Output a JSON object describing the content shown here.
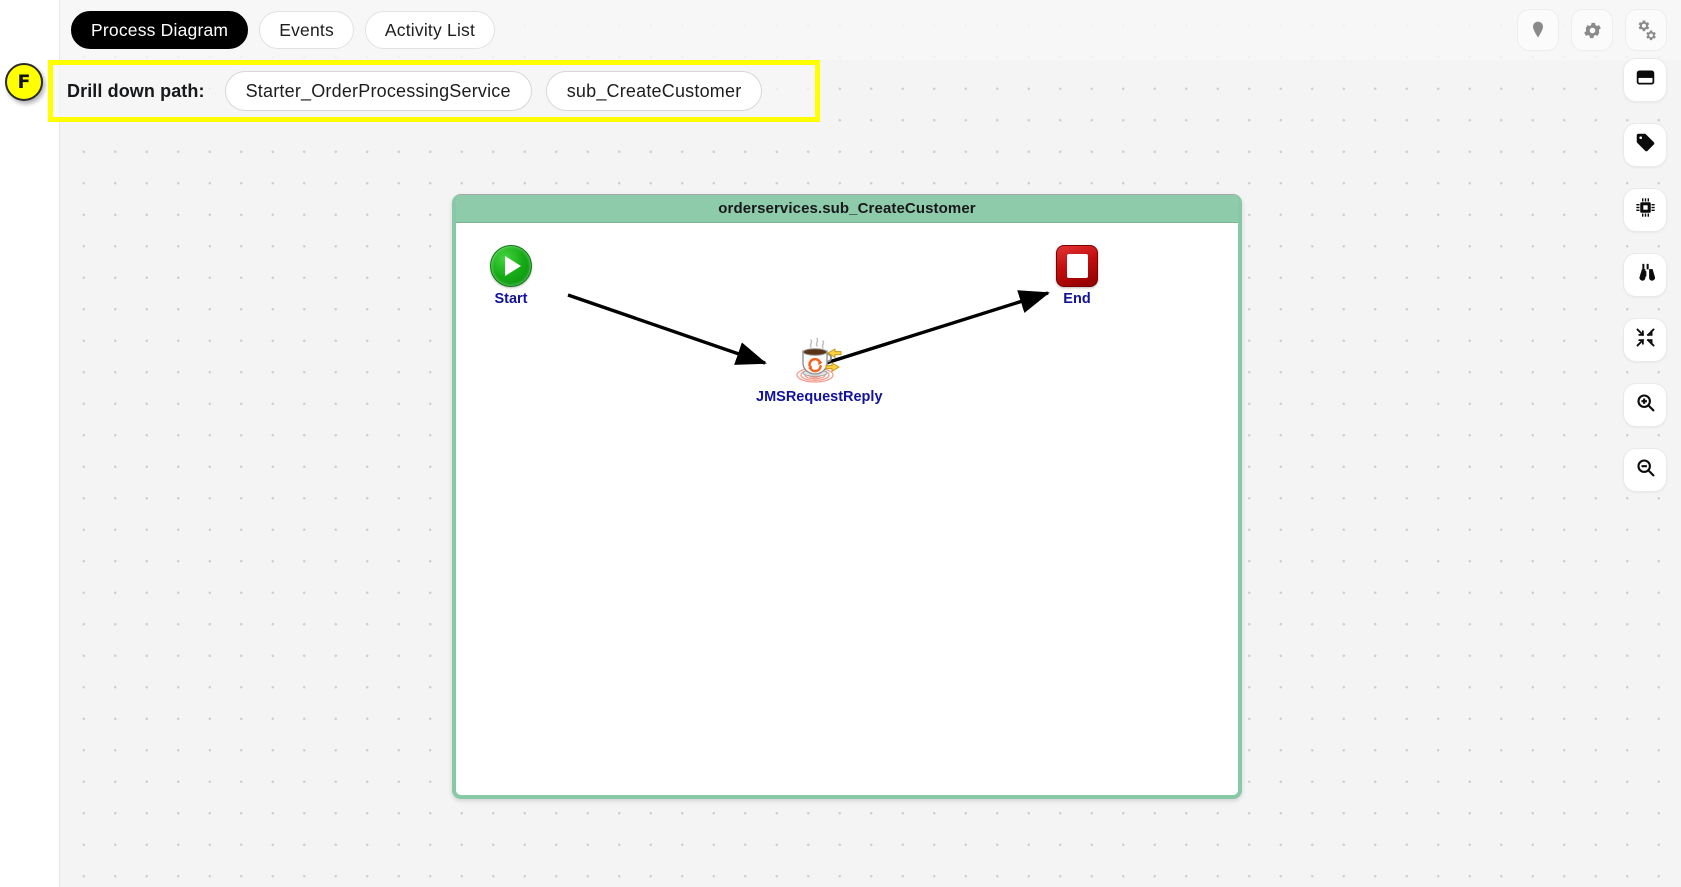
{
  "tabs": [
    {
      "label": "Process Diagram",
      "active": true
    },
    {
      "label": "Events",
      "active": false
    },
    {
      "label": "Activity List",
      "active": false
    }
  ],
  "header_actions": [
    {
      "name": "location-pin-icon",
      "label": "Location"
    },
    {
      "name": "gear-icon",
      "label": "Settings"
    },
    {
      "name": "double-gear-icon",
      "label": "Advanced settings"
    }
  ],
  "marker": {
    "letter": "F"
  },
  "drilldown": {
    "label": "Drill down path:",
    "highlight_color": "#ffff00",
    "crumbs": [
      {
        "label": "Starter_OrderProcessingService"
      },
      {
        "label": "sub_CreateCustomer"
      }
    ]
  },
  "right_toolbar": [
    {
      "name": "panel-window-icon",
      "label": "Toggle panel"
    },
    {
      "name": "tag-icon",
      "label": "Labels"
    },
    {
      "name": "chip-icon",
      "label": "Components"
    },
    {
      "name": "binoculars-icon",
      "label": "Inspect"
    },
    {
      "name": "collapse-icon",
      "label": "Fit to screen"
    },
    {
      "name": "zoom-in-icon",
      "label": "Zoom in"
    },
    {
      "name": "zoom-out-icon",
      "label": "Zoom out"
    }
  ],
  "diagram": {
    "title": "orderservices.sub_CreateCustomer",
    "header_color": "#8ecbaa",
    "nodes": [
      {
        "id": "start",
        "label": "Start",
        "type": "start-event"
      },
      {
        "id": "jms",
        "label": "JMSRequestReply",
        "type": "jms-request-reply"
      },
      {
        "id": "end",
        "label": "End",
        "type": "end-event"
      }
    ],
    "links": [
      {
        "from": "start",
        "to": "jms"
      },
      {
        "from": "jms",
        "to": "end"
      }
    ],
    "label_color": "#12129c"
  }
}
